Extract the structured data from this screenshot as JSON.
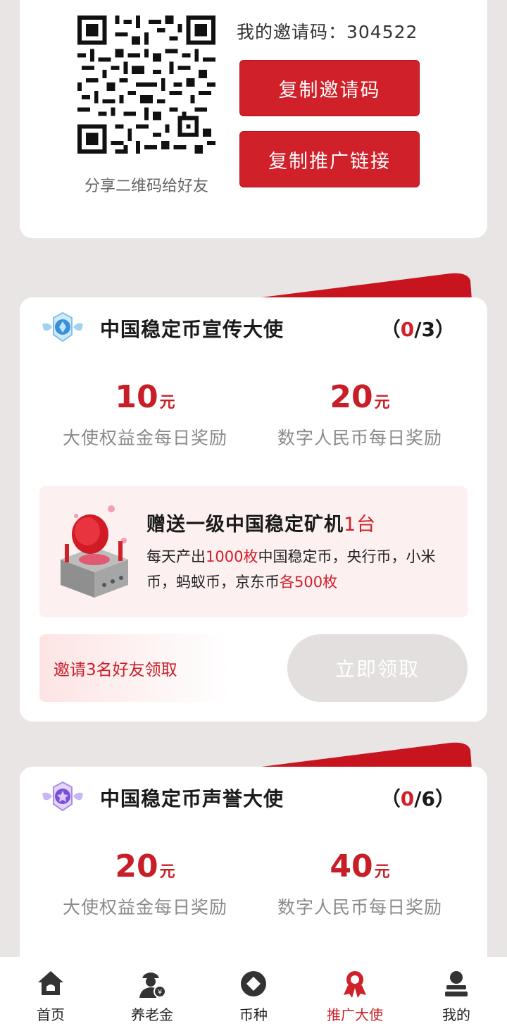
{
  "invite": {
    "code_label": "我的邀请码：304522",
    "qr_caption": "分享二维码给好友",
    "copy_code_label": "复制邀请码",
    "copy_link_label": "复制推广链接"
  },
  "ambassadors": [
    {
      "title": "中国稳定币宣传大使",
      "progress_open": "（",
      "progress_current": "0",
      "progress_total": "/3）",
      "reward_left_amount": "10",
      "reward_left_unit": "元",
      "reward_left_desc": "大使权益金每日奖励",
      "reward_right_amount": "20",
      "reward_right_unit": "元",
      "reward_right_desc": "数字人民币每日奖励",
      "gift_title": "赠送一级中国稳定矿机",
      "gift_title_hl": "1台",
      "gift_line_a": "每天产出",
      "gift_line_hl1": "1000枚",
      "gift_line_b": "中国稳定币，央行币，小米币，蚂蚁币，京东币",
      "gift_line_hl2": "各500枚",
      "invite_tip": "邀请3名好友领取",
      "claim_label": "立即领取"
    },
    {
      "title": "中国稳定币声誉大使",
      "progress_open": "（",
      "progress_current": "0",
      "progress_total": "/6）",
      "reward_left_amount": "20",
      "reward_left_unit": "元",
      "reward_left_desc": "大使权益金每日奖励",
      "reward_right_amount": "40",
      "reward_right_unit": "元",
      "reward_right_desc": "数字人民币每日奖励"
    }
  ],
  "nav": {
    "items": [
      {
        "label": "首页",
        "icon": "home-icon"
      },
      {
        "label": "养老金",
        "icon": "pension-icon"
      },
      {
        "label": "币种",
        "icon": "coin-icon"
      },
      {
        "label": "推广大使",
        "icon": "ambassador-icon"
      },
      {
        "label": "我的",
        "icon": "profile-icon"
      }
    ],
    "active_index": 3
  },
  "colors": {
    "accent": "#d0202a",
    "background": "#e8e5e4",
    "disabled_button": "#e4dfdf"
  }
}
